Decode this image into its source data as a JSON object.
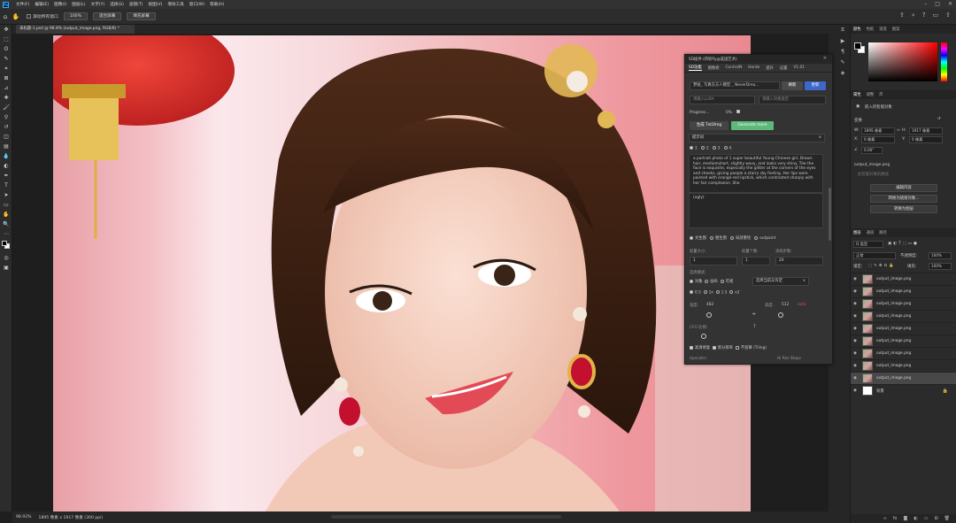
{
  "menubar": {
    "logo": "Ps",
    "items": [
      "文件(F)",
      "编辑(E)",
      "图像(I)",
      "图层(L)",
      "文字(Y)",
      "选择(S)",
      "滤镜(T)",
      "视图(V)",
      "增效工具",
      "窗口(W)",
      "帮助(H)"
    ]
  },
  "options": {
    "check_label": "滚动所有窗口",
    "zoom": "100%",
    "fit_btn": "适合屏幕",
    "fill_btn": "填充屏幕"
  },
  "document": {
    "tab_title": "未标题-1.psd @ 98.8% (output_image.png, RGB/8) *"
  },
  "status": {
    "zoom": "98.92%",
    "size": "1895 像素 x 1917 像素 (300 ppi)"
  },
  "color_panel": {
    "tabs": [
      "颜色",
      "色板",
      "渐变",
      "图案"
    ]
  },
  "properties": {
    "tabs": [
      "属性",
      "调整",
      "库"
    ],
    "layer_kind": "嵌入的智能对象",
    "section": "变换",
    "w_label": "W:",
    "w_val": "1895 像素",
    "h_label": "H:",
    "h_val": "1917 像素",
    "x_label": "X:",
    "x_val": "0 像素",
    "y_label": "Y:",
    "y_val": "0 像素",
    "angle": "0.00°",
    "file_name": "output_image.png",
    "path_hint": "此智能对象的路径",
    "btn_edit": "编辑内容",
    "btn_convert": "转换为链接对象...",
    "btn_layer": "转换为图层"
  },
  "layers": {
    "tabs": [
      "图层",
      "通道",
      "路径"
    ],
    "kind": "Q 类型",
    "blend": "正常",
    "opacity_label": "不透明度:",
    "opacity": "100%",
    "lock_label": "锁定:",
    "fill_label": "填充:",
    "fill": "100%",
    "items": [
      "output_image.png",
      "output_image.png",
      "output_image.png",
      "output_image.png",
      "output_image.png",
      "output_image.png",
      "output_image.png",
      "output_image.png",
      "output_image.png"
    ],
    "background": "背景"
  },
  "sd": {
    "title": "SD插件 (四轮fly@美国艺术)",
    "tabs": [
      "SD功能",
      "图像修",
      "ControlN",
      "Horde",
      "提升",
      "设置",
      "V1.01"
    ],
    "model": "梦丽_ 写真东方人模型 _ NeverDrea...",
    "refresh": "刷新",
    "update": "更新",
    "in1_ph": "请输入LoRA",
    "in2_ph": "请输入风格类型",
    "progress_label": "Progress...",
    "progress_val": "0%",
    "btn_generate": "生成 Txt2Img",
    "btn_generate_more": "Generate more",
    "prompt_header": "提示词",
    "radios": [
      "1",
      "2",
      "3",
      "4"
    ],
    "prompt": "a portrait photo of 1 super beautiful Young Chinese girl, Brown hair, mediumshort, slightly wavy, and looks very shiny. The  the face is exquisite, especially the glitter at the corners of the eyes and cheeks, giving people a starry sky feeling. Her lips were painted with orange-red lipstick, which contrasted sharply with her fair complexion. She",
    "negative": "(ugly)",
    "modes": [
      "文生图",
      "图生图",
      "局部重绘",
      "outpaint"
    ],
    "batch_label": "批量大小:",
    "batch_val": "1",
    "count_label": "批量个数:",
    "count_val": "1",
    "steps_label": "采样步数:",
    "steps_val": "20",
    "sel_label": "选择模式:",
    "sel_opts": [
      "对象",
      "画布",
      "可视"
    ],
    "sel_dropdown": "选择当前又有定",
    "size_opts": [
      "0.5",
      "1x",
      "1.5",
      "x2"
    ],
    "w_label": "宽度:",
    "w_val": "482",
    "h_label": "高度:",
    "h_val": "512",
    "h_extra": "auto",
    "cfg_label": "CFG 比例:",
    "cfg_val": "7",
    "chk1": "高清修复",
    "chk2": "新分辨率",
    "chk3": "不遮罩 (Tiling)",
    "upscaler": "Upscaler:",
    "upscaler_val": "Hi Res Steps"
  }
}
